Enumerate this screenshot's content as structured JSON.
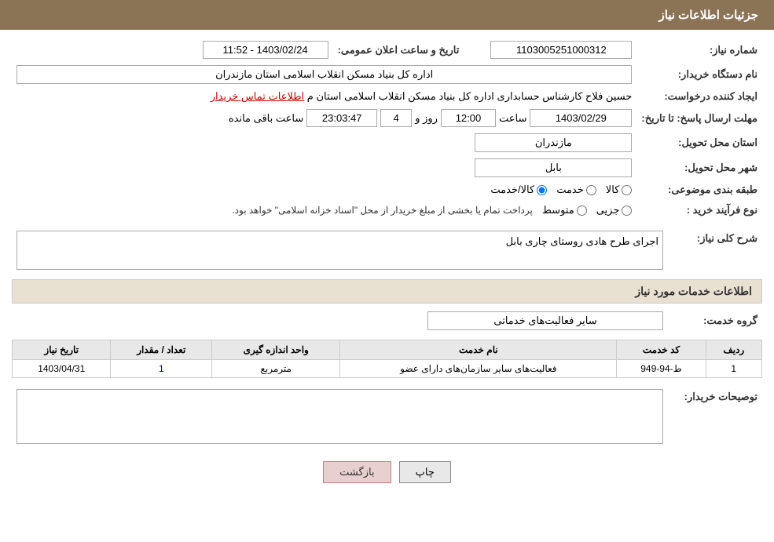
{
  "page": {
    "title": "جزئیات اطلاعات نیاز"
  },
  "header": {
    "label": "جزئیات اطلاعات نیاز"
  },
  "fields": {
    "need_number_label": "شماره نیاز:",
    "need_number_value": "1103005251000312",
    "date_label": "تاریخ و ساعت اعلان عمومی:",
    "date_value": "1403/02/24 - 11:52",
    "organization_label": "نام دستگاه خریدار:",
    "organization_value": "اداره کل بنیاد مسکن انقلاب اسلامی استان مازندران",
    "creator_label": "ایجاد کننده درخواست:",
    "creator_value": "حسین فلاح کارشناس حسابداری اداره کل بنیاد مسکن انقلاب اسلامی استان م",
    "contact_link": "اطلاعات تماس خریدار",
    "deadline_label": "مهلت ارسال پاسخ: تا تاریخ:",
    "deadline_date": "1403/02/29",
    "deadline_time_label": "ساعت",
    "deadline_time": "12:00",
    "deadline_day_label": "روز و",
    "deadline_days": "4",
    "deadline_remaining_label": "ساعت باقی مانده",
    "deadline_remaining": "23:03:47",
    "province_label": "استان محل تحویل:",
    "province_value": "مازندران",
    "city_label": "شهر محل تحویل:",
    "city_value": "بابل",
    "category_label": "طبقه بندی موضوعی:",
    "category_radio1": "کالا",
    "category_radio2": "خدمت",
    "category_radio3": "کالا/خدمت",
    "purchase_type_label": "نوع فرآیند خرید :",
    "purchase_radio1": "جزیی",
    "purchase_radio2": "متوسط",
    "purchase_notice": "پرداخت تمام یا بخشی از مبلغ خریدار از محل \"اسناد خزانه اسلامی\" خواهد بود.",
    "description_section": "شرح کلی نیاز:",
    "description_value": "اجرای طرح هادی روستای چاری بابل",
    "services_section": "اطلاعات خدمات مورد نیاز",
    "service_group_label": "گروه خدمت:",
    "service_group_value": "سایر فعالیت‌های خدماتی",
    "table": {
      "col_row": "ردیف",
      "col_code": "کد خدمت",
      "col_name": "نام خدمت",
      "col_unit": "واحد اندازه گیری",
      "col_qty": "تعداد / مقدار",
      "col_date": "تاریخ نیاز",
      "rows": [
        {
          "row": "1",
          "code": "ط-94-949",
          "name": "فعالیت‌های سایر سازمان‌های دارای عضو",
          "unit": "مترمربع",
          "qty": "1",
          "date": "1403/04/31"
        }
      ]
    },
    "buyer_desc_label": "توصیحات خریدار:",
    "buyer_desc_value": ""
  },
  "buttons": {
    "print": "چاپ",
    "back": "بازگشت"
  }
}
